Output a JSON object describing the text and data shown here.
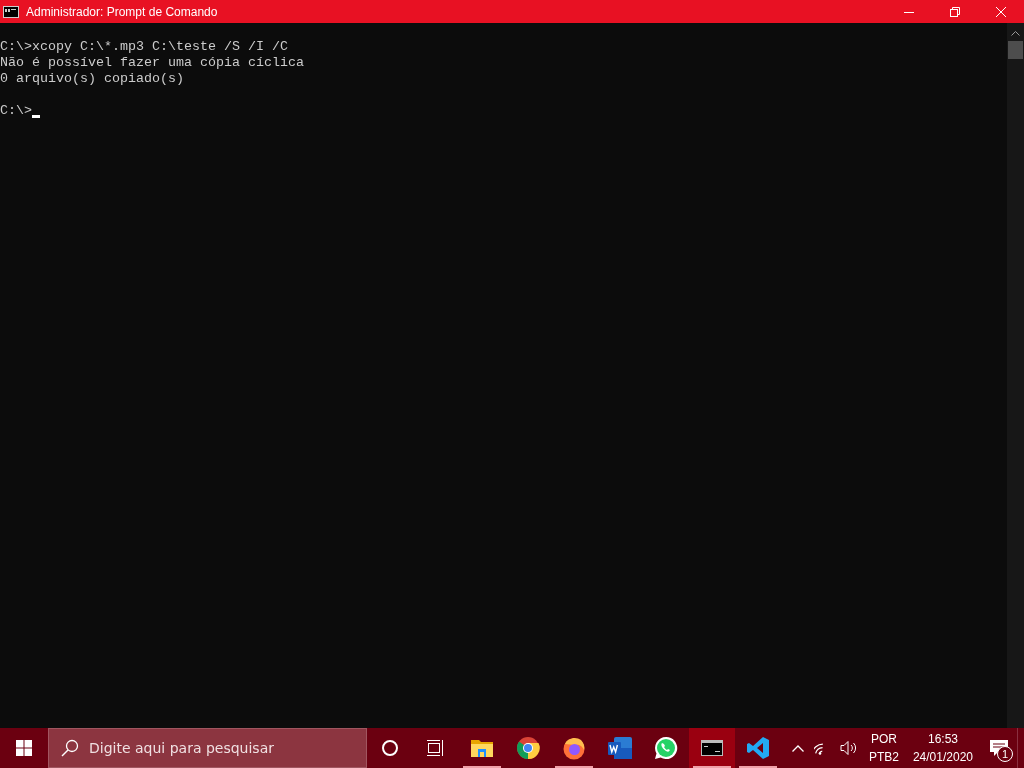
{
  "window": {
    "title": "Administrador: Prompt de Comando"
  },
  "console": {
    "lines": [
      "C:\\>xcopy C:\\*.mp3 C:\\teste /S /I /C",
      "Não é possível fazer uma cópia cíclica",
      "0 arquivo(s) copiado(s)"
    ],
    "prompt": "C:\\>"
  },
  "taskbar": {
    "search": {
      "placeholder": "Digite aqui para pesquisar"
    },
    "apps": [
      {
        "kind": "explorer",
        "running": true,
        "active": false
      },
      {
        "kind": "chrome",
        "running": false,
        "active": false
      },
      {
        "kind": "firefox",
        "running": true,
        "active": false
      },
      {
        "kind": "word",
        "running": false,
        "active": false
      },
      {
        "kind": "whatsapp",
        "running": false,
        "active": false
      },
      {
        "kind": "terminal",
        "running": true,
        "active": true
      },
      {
        "kind": "vscode",
        "running": true,
        "active": false
      }
    ],
    "tray": {
      "language": "POR",
      "layout": "PTB2",
      "time": "16:53",
      "date": "24/01/2020",
      "notifications": "1"
    }
  }
}
